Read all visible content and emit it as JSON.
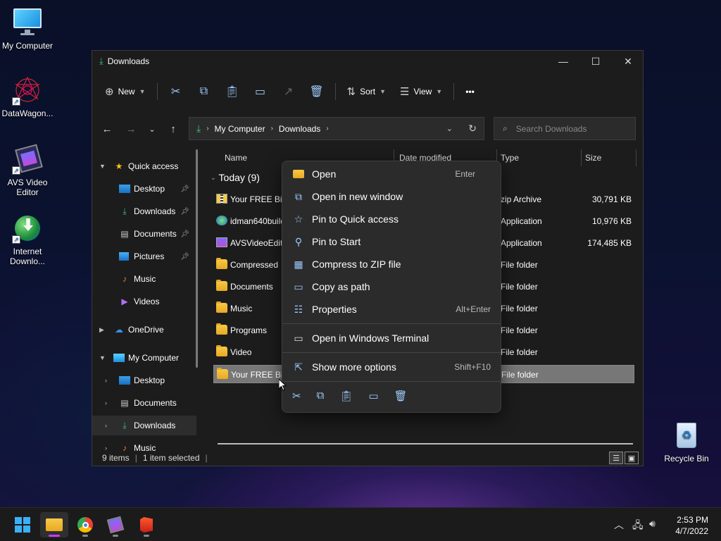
{
  "desktop": {
    "icons": [
      {
        "label": "My Computer"
      },
      {
        "label": "DataWagon..."
      },
      {
        "label": "AVS Video Editor"
      },
      {
        "label": "Internet Downlo..."
      },
      {
        "label": "Recycle Bin"
      }
    ]
  },
  "window": {
    "title": "Downloads",
    "controls": {
      "minimize": "—",
      "maximize": "☐",
      "close": "✕"
    },
    "toolbar": {
      "new_label": "New",
      "sort_label": "Sort",
      "view_label": "View",
      "more_label": "•••"
    },
    "address": {
      "crumbs": [
        "My Computer",
        "Downloads"
      ],
      "search_placeholder": "Search Downloads"
    },
    "nav": {
      "quick_access": "Quick access",
      "quick_items": [
        "Desktop",
        "Downloads",
        "Documents",
        "Pictures",
        "Music",
        "Videos"
      ],
      "onedrive": "OneDrive",
      "my_computer": "My Computer",
      "pc_items": [
        "Desktop",
        "Documents",
        "Downloads",
        "Music"
      ]
    },
    "columns": {
      "name": "Name",
      "date": "Date modified",
      "type": "Type",
      "size": "Size"
    },
    "group_label": "Today (9)",
    "files": [
      {
        "name": "Your FREE BitE",
        "type": "zip Archive",
        "size": "30,791 KB",
        "icon": "zip-icon"
      },
      {
        "name": "idman640build",
        "type": "Application",
        "size": "10,976 KB",
        "icon": "app-icon"
      },
      {
        "name": "AVSVideoEdito",
        "type": "Application",
        "size": "174,485 KB",
        "icon": "app-icon"
      },
      {
        "name": "Compressed",
        "type": "File folder",
        "size": "",
        "icon": "folder-icon"
      },
      {
        "name": "Documents",
        "type": "File folder",
        "size": "",
        "icon": "folder-icon"
      },
      {
        "name": "Music",
        "type": "File folder",
        "size": "",
        "icon": "folder-icon"
      },
      {
        "name": "Programs",
        "type": "File folder",
        "size": "",
        "icon": "folder-icon"
      },
      {
        "name": "Video",
        "type": "File folder",
        "size": "",
        "icon": "folder-icon"
      },
      {
        "name": "Your FREE BitE",
        "type": "File folder",
        "size": "",
        "icon": "folder-icon"
      }
    ],
    "status": {
      "count": "9 items",
      "selected": "1 item selected"
    }
  },
  "context_menu": {
    "items": [
      {
        "label": "Open",
        "shortcut": "Enter"
      },
      {
        "label": "Open in new window",
        "shortcut": ""
      },
      {
        "label": "Pin to Quick access",
        "shortcut": ""
      },
      {
        "label": "Pin to Start",
        "shortcut": ""
      },
      {
        "label": "Compress to ZIP file",
        "shortcut": ""
      },
      {
        "label": "Copy as path",
        "shortcut": ""
      },
      {
        "label": "Properties",
        "shortcut": "Alt+Enter"
      },
      {
        "label": "Open in Windows Terminal",
        "shortcut": ""
      },
      {
        "label": "Show more options",
        "shortcut": "Shift+F10"
      }
    ]
  },
  "taskbar": {
    "time": "2:53 PM",
    "date": "4/7/2022"
  },
  "colors": {
    "accent": "#9ecbff",
    "folder": "#f7c948",
    "active_indicator": "#c43cf0"
  }
}
